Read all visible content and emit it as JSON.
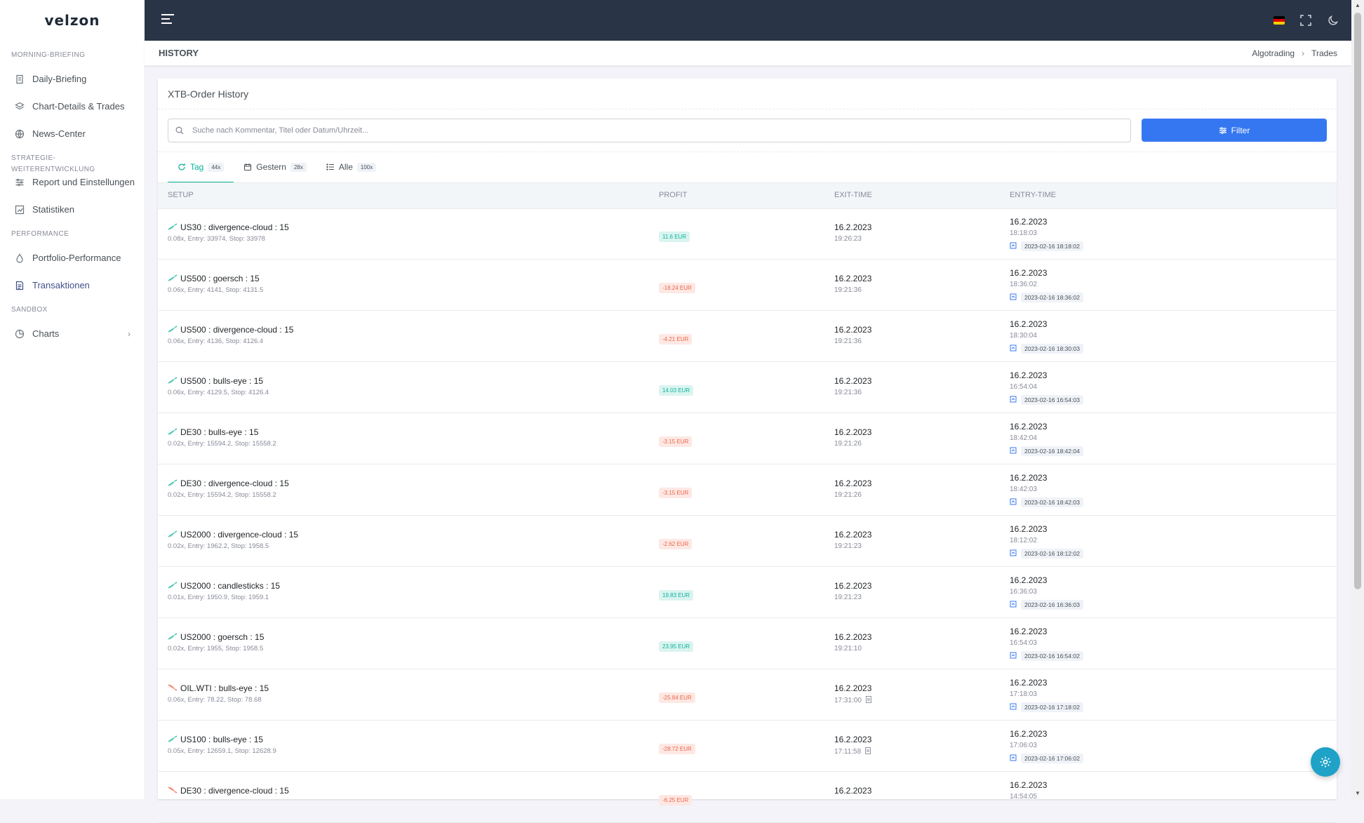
{
  "app": {
    "logo": "velzon"
  },
  "sidebar": {
    "sections": [
      {
        "title": "MORNING-BRIEFING",
        "items": [
          {
            "label": "Daily-Briefing",
            "icon": "file-shield-icon"
          },
          {
            "label": "Chart-Details & Trades",
            "icon": "layers-icon"
          },
          {
            "label": "News-Center",
            "icon": "globe-icon"
          }
        ]
      },
      {
        "title": "STRATEGIE-WEITERENTWICKLUNG",
        "items": [
          {
            "label": "Report und Einstellungen",
            "icon": "sliders-icon"
          },
          {
            "label": "Statistiken",
            "icon": "chart-box-icon"
          }
        ]
      },
      {
        "title": "PERFORMANCE",
        "items": [
          {
            "label": "Portfolio-Performance",
            "icon": "drop-icon"
          },
          {
            "label": "Transaktionen",
            "icon": "document-icon",
            "active": true
          }
        ]
      },
      {
        "title": "SANDBOX",
        "items": [
          {
            "label": "Charts",
            "icon": "pie-icon",
            "has_children": true
          }
        ]
      }
    ]
  },
  "pagebar": {
    "title": "HISTORY",
    "breadcrumbs": [
      "Algotrading",
      "Trades"
    ]
  },
  "card": {
    "title": "XTB-Order History",
    "search_placeholder": "Suche nach Kommentar, Titel oder Datum/Uhrzeit...",
    "filter_label": "Filter",
    "tabs": [
      {
        "label": "Tag",
        "count": "44x",
        "active": true
      },
      {
        "label": "Gestern",
        "count": "28x"
      },
      {
        "label": "Alle",
        "count": "100x"
      }
    ],
    "columns": [
      "SETUP",
      "PROFIT",
      "EXIT-TIME",
      "ENTRY-TIME"
    ],
    "rows": [
      {
        "dir": "up",
        "title": "US30 : divergence-cloud : 15",
        "sub": "0.08x, Entry: 33974, Stop: 33978",
        "profit": "11.6 EUR",
        "pos": true,
        "exit_date": "16.2.2023",
        "exit_time": "19:26:23",
        "exit_flag": false,
        "entry_date": "16.2.2023",
        "entry_time": "18:18:03",
        "entry_stamp": "2023-02-16 18:18:02"
      },
      {
        "dir": "up",
        "title": "US500 : goersch : 15",
        "sub": "0.06x, Entry: 4141, Stop: 4131.5",
        "profit": "-18.24 EUR",
        "pos": false,
        "exit_date": "16.2.2023",
        "exit_time": "19:21:36",
        "exit_flag": false,
        "entry_date": "16.2.2023",
        "entry_time": "18:36:02",
        "entry_stamp": "2023-02-16 18:36:02"
      },
      {
        "dir": "up",
        "title": "US500 : divergence-cloud : 15",
        "sub": "0.06x, Entry: 4136, Stop: 4126.4",
        "profit": "-4.21 EUR",
        "pos": false,
        "exit_date": "16.2.2023",
        "exit_time": "19:21:36",
        "exit_flag": false,
        "entry_date": "16.2.2023",
        "entry_time": "18:30:04",
        "entry_stamp": "2023-02-16 18:30:03"
      },
      {
        "dir": "up",
        "title": "US500 : bulls-eye : 15",
        "sub": "0.06x, Entry: 4129.5, Stop: 4126.4",
        "profit": "14.03 EUR",
        "pos": true,
        "exit_date": "16.2.2023",
        "exit_time": "19:21:36",
        "exit_flag": false,
        "entry_date": "16.2.2023",
        "entry_time": "16:54:04",
        "entry_stamp": "2023-02-16 16:54:03"
      },
      {
        "dir": "up",
        "title": "DE30 : bulls-eye : 15",
        "sub": "0.02x, Entry: 15594.2, Stop: 15558.2",
        "profit": "-3.15 EUR",
        "pos": false,
        "exit_date": "16.2.2023",
        "exit_time": "19:21:26",
        "exit_flag": false,
        "entry_date": "16.2.2023",
        "entry_time": "18:42:04",
        "entry_stamp": "2023-02-16 18:42:04"
      },
      {
        "dir": "up",
        "title": "DE30 : divergence-cloud : 15",
        "sub": "0.02x, Entry: 15594.2, Stop: 15558.2",
        "profit": "-3.15 EUR",
        "pos": false,
        "exit_date": "16.2.2023",
        "exit_time": "19:21:26",
        "exit_flag": false,
        "entry_date": "16.2.2023",
        "entry_time": "18:42:03",
        "entry_stamp": "2023-02-16 18:42:03"
      },
      {
        "dir": "up",
        "title": "US2000 : divergence-cloud : 15",
        "sub": "0.02x, Entry: 1962.2, Stop: 1958.5",
        "profit": "-2.62 EUR",
        "pos": false,
        "exit_date": "16.2.2023",
        "exit_time": "19:21:23",
        "exit_flag": false,
        "entry_date": "16.2.2023",
        "entry_time": "18:12:02",
        "entry_stamp": "2023-02-16 18:12:02"
      },
      {
        "dir": "up",
        "title": "US2000 : candlesticks : 15",
        "sub": "0.01x, Entry: 1950.9, Stop: 1959.1",
        "profit": "19.83 EUR",
        "pos": true,
        "exit_date": "16.2.2023",
        "exit_time": "19:21:23",
        "exit_flag": false,
        "entry_date": "16.2.2023",
        "entry_time": "16:36:03",
        "entry_stamp": "2023-02-16 16:36:03"
      },
      {
        "dir": "up",
        "title": "US2000 : goersch : 15",
        "sub": "0.02x, Entry: 1955, Stop: 1958.5",
        "profit": "23.95 EUR",
        "pos": true,
        "exit_date": "16.2.2023",
        "exit_time": "19:21:10",
        "exit_flag": false,
        "entry_date": "16.2.2023",
        "entry_time": "16:54:03",
        "entry_stamp": "2023-02-16 16:54:02"
      },
      {
        "dir": "down",
        "title": "OIL.WTI : bulls-eye : 15",
        "sub": "0.06x, Entry: 78.22, Stop: 78.68",
        "profit": "-25.84 EUR",
        "pos": false,
        "exit_date": "16.2.2023",
        "exit_time": "17:31:00",
        "exit_flag": true,
        "entry_date": "16.2.2023",
        "entry_time": "17:18:03",
        "entry_stamp": "2023-02-16 17:18:02"
      },
      {
        "dir": "up",
        "title": "US100 : bulls-eye : 15",
        "sub": "0.05x, Entry: 12659.1, Stop: 12628.9",
        "profit": "-28.72 EUR",
        "pos": false,
        "exit_date": "16.2.2023",
        "exit_time": "17:11:58",
        "exit_flag": true,
        "entry_date": "16.2.2023",
        "entry_time": "17:06:03",
        "entry_stamp": "2023-02-16 17:06:02"
      },
      {
        "dir": "down",
        "title": "DE30 : divergence-cloud : 15",
        "sub": "",
        "profit": "-6.25 EUR",
        "pos": false,
        "exit_date": "16.2.2023",
        "exit_time": "",
        "exit_flag": false,
        "entry_date": "16.2.2023",
        "entry_time": "14:54:05",
        "entry_stamp": ""
      }
    ]
  },
  "colors": {
    "topbar": "#2a3447",
    "accent": "#3577f1",
    "success": "#0ab39c",
    "danger": "#f06548",
    "fab": "#1fa2c7"
  }
}
